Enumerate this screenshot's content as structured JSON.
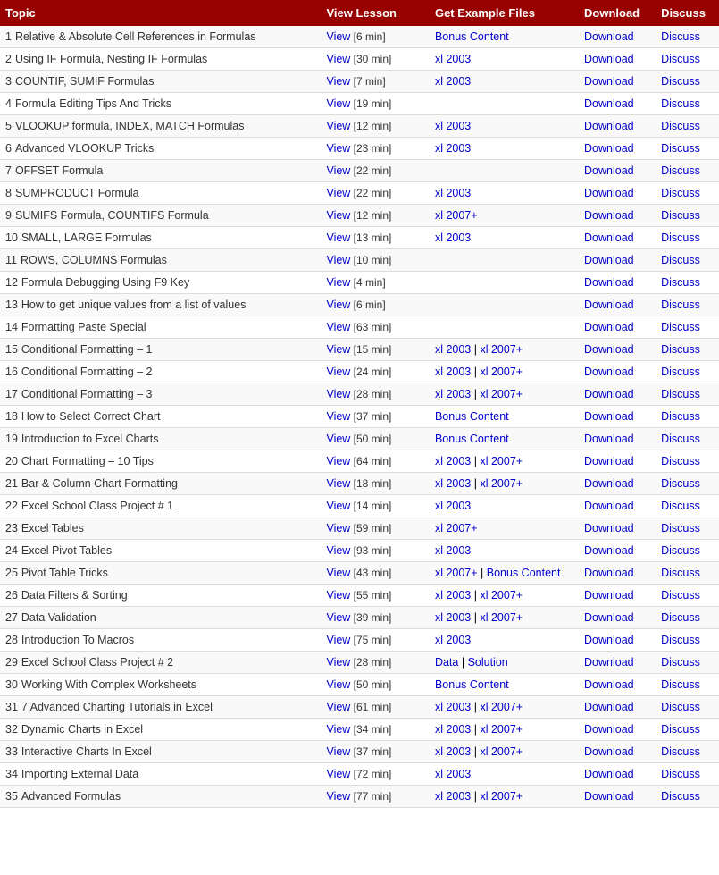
{
  "header": {
    "topic": "Topic",
    "view_lesson": "View Lesson",
    "get_example": "Get Example Files",
    "download": "Download",
    "discuss": "Discuss"
  },
  "rows": [
    {
      "num": 1,
      "topic": "Relative & Absolute Cell References in Formulas",
      "topic_link": false,
      "view": "View",
      "duration": "6 min",
      "example": [
        {
          "label": "Bonus Content",
          "type": "bonus"
        }
      ],
      "download": true,
      "discuss": true
    },
    {
      "num": 2,
      "topic": "Using IF Formula, Nesting IF Formulas",
      "topic_link": false,
      "view": "View",
      "duration": "30 min",
      "example": [
        {
          "label": "xl 2003",
          "type": "xl2003"
        }
      ],
      "download": true,
      "discuss": true
    },
    {
      "num": 3,
      "topic": "COUNTIF, SUMIF Formulas",
      "topic_link": false,
      "view": "View",
      "duration": "7 min",
      "example": [
        {
          "label": "xl 2003",
          "type": "xl2003"
        }
      ],
      "download": true,
      "discuss": true
    },
    {
      "num": 4,
      "topic": "Formula Editing Tips And Tricks",
      "topic_link": false,
      "view": "View",
      "duration": "19 min",
      "example": [],
      "download": true,
      "discuss": true
    },
    {
      "num": 5,
      "topic": "VLOOKUP formula, INDEX, MATCH Formulas",
      "topic_link": false,
      "view": "View",
      "duration": "12 min",
      "example": [
        {
          "label": "xl 2003",
          "type": "xl2003"
        }
      ],
      "download": true,
      "discuss": true
    },
    {
      "num": 6,
      "topic": "Advanced VLOOKUP Tricks",
      "topic_link": false,
      "view": "View",
      "duration": "23 min",
      "example": [
        {
          "label": "xl 2003",
          "type": "xl2003"
        }
      ],
      "download": true,
      "discuss": true
    },
    {
      "num": 7,
      "topic": "OFFSET Formula",
      "topic_link": false,
      "view": "View",
      "duration": "22 min",
      "example": [],
      "download": true,
      "discuss": true
    },
    {
      "num": 8,
      "topic": "SUMPRODUCT Formula",
      "topic_link": false,
      "view": "View",
      "duration": "22 min",
      "example": [
        {
          "label": "xl 2003",
          "type": "xl2003"
        }
      ],
      "download": true,
      "discuss": true
    },
    {
      "num": 9,
      "topic": "SUMIFS Formula, COUNTIFS Formula",
      "topic_link": false,
      "view": "View",
      "duration": "12 min",
      "example": [
        {
          "label": "xl 2007+",
          "type": "xl2007"
        }
      ],
      "download": true,
      "discuss": true
    },
    {
      "num": 10,
      "topic": "SMALL, LARGE Formulas",
      "topic_link": false,
      "view": "View",
      "duration": "13 min",
      "example": [
        {
          "label": "xl 2003",
          "type": "xl2003"
        }
      ],
      "download": true,
      "discuss": true
    },
    {
      "num": 11,
      "topic": "ROWS, COLUMNS Formulas",
      "topic_link": false,
      "view": "View",
      "duration": "10 min",
      "example": [],
      "download": true,
      "discuss": true
    },
    {
      "num": 12,
      "topic": "Formula Debugging Using F9 Key",
      "topic_link": false,
      "view": "View",
      "duration": "4 min",
      "example": [],
      "download": true,
      "discuss": true
    },
    {
      "num": 13,
      "topic": "How to get unique values from a list of values",
      "topic_link": false,
      "view": "View",
      "duration": "6 min",
      "example": [],
      "download": true,
      "discuss": true
    },
    {
      "num": 14,
      "topic": "Formatting Paste Special",
      "topic_link": false,
      "view": "View",
      "duration": "63 min",
      "example": [],
      "download": true,
      "discuss": true
    },
    {
      "num": 15,
      "topic": "Conditional Formatting – 1",
      "topic_link": false,
      "view": "View",
      "duration": "15 min",
      "example": [
        {
          "label": "xl 2003",
          "type": "xl2003"
        },
        {
          "label": "xl 2007+",
          "type": "xl2007"
        }
      ],
      "download": true,
      "discuss": true
    },
    {
      "num": 16,
      "topic": "Conditional Formatting – 2",
      "topic_link": false,
      "view": "View",
      "duration": "24 min",
      "example": [
        {
          "label": "xl 2003",
          "type": "xl2003"
        },
        {
          "label": "xl 2007+",
          "type": "xl2007"
        }
      ],
      "download": true,
      "discuss": true
    },
    {
      "num": 17,
      "topic": "Conditional Formatting – 3",
      "topic_link": false,
      "view": "View",
      "duration": "28 min",
      "example": [
        {
          "label": "xl 2003",
          "type": "xl2003"
        },
        {
          "label": "xl 2007+",
          "type": "xl2007"
        }
      ],
      "download": true,
      "discuss": true
    },
    {
      "num": 18,
      "topic": "How to Select Correct Chart",
      "topic_link": false,
      "view": "View",
      "duration": "37 min",
      "example": [
        {
          "label": "Bonus Content",
          "type": "bonus"
        }
      ],
      "download": true,
      "discuss": true
    },
    {
      "num": 19,
      "topic": "Introduction to Excel Charts",
      "topic_link": false,
      "view": "View",
      "duration": "50 min",
      "example": [
        {
          "label": "Bonus Content",
          "type": "bonus"
        }
      ],
      "download": true,
      "discuss": true
    },
    {
      "num": 20,
      "topic": "Chart Formatting – 10 Tips",
      "topic_link": false,
      "view": "View",
      "duration": "64 min",
      "example": [
        {
          "label": "xl 2003",
          "type": "xl2003"
        },
        {
          "label": "xl 2007+",
          "type": "xl2007"
        }
      ],
      "download": true,
      "discuss": true
    },
    {
      "num": 21,
      "topic": "Bar & Column Chart Formatting",
      "topic_link": false,
      "view": "View",
      "duration": "18 min",
      "example": [
        {
          "label": "xl 2003",
          "type": "xl2003"
        },
        {
          "label": "xl 2007+",
          "type": "xl2007"
        }
      ],
      "download": true,
      "discuss": true
    },
    {
      "num": 22,
      "topic": "Excel School Class Project # 1",
      "topic_link": false,
      "view": "View",
      "duration": "14 min",
      "example": [
        {
          "label": "xl 2003",
          "type": "xl2003"
        }
      ],
      "download": true,
      "discuss": true
    },
    {
      "num": 23,
      "topic": "Excel Tables",
      "topic_link": false,
      "view": "View",
      "duration": "59 min",
      "example": [
        {
          "label": "xl 2007+",
          "type": "xl2007"
        }
      ],
      "download": true,
      "discuss": true
    },
    {
      "num": 24,
      "topic": "Excel Pivot Tables",
      "topic_link": false,
      "view": "View",
      "duration": "93 min",
      "example": [
        {
          "label": "xl 2003",
          "type": "xl2003"
        }
      ],
      "download": true,
      "discuss": true
    },
    {
      "num": 25,
      "topic": "Pivot Table Tricks",
      "topic_link": false,
      "view": "View",
      "duration": "43 min",
      "example": [
        {
          "label": "xl 2007+",
          "type": "xl2007"
        },
        {
          "label": "Bonus Content",
          "type": "bonus"
        }
      ],
      "download": true,
      "discuss": true
    },
    {
      "num": 26,
      "topic": "Data Filters & Sorting",
      "topic_link": false,
      "view": "View",
      "duration": "55 min",
      "example": [
        {
          "label": "xl 2003",
          "type": "xl2003"
        },
        {
          "label": "xl 2007+",
          "type": "xl2007"
        }
      ],
      "download": true,
      "discuss": true
    },
    {
      "num": 27,
      "topic": "Data Validation",
      "topic_link": false,
      "view": "View",
      "duration": "39 min",
      "example": [
        {
          "label": "xl 2003",
          "type": "xl2003"
        },
        {
          "label": "xl 2007+",
          "type": "xl2007"
        }
      ],
      "download": true,
      "discuss": true
    },
    {
      "num": 28,
      "topic": "Introduction To Macros",
      "topic_link": false,
      "view": "View",
      "duration": "75 min",
      "example": [
        {
          "label": "xl 2003",
          "type": "xl2003"
        }
      ],
      "download": true,
      "discuss": true
    },
    {
      "num": 29,
      "topic": "Excel School Class Project # 2",
      "topic_link": false,
      "view": "View",
      "duration": "28 min",
      "example": [
        {
          "label": "Data",
          "type": "data"
        },
        {
          "label": "Solution",
          "type": "solution"
        }
      ],
      "download": true,
      "discuss": true
    },
    {
      "num": 30,
      "topic": "Working With Complex Worksheets",
      "topic_link": false,
      "view": "View",
      "duration": "50 min",
      "example": [
        {
          "label": "Bonus Content",
          "type": "bonus"
        }
      ],
      "download": true,
      "discuss": true
    },
    {
      "num": 31,
      "topic": "7 Advanced Charting Tutorials in Excel",
      "topic_link": false,
      "view": "View",
      "duration": "61 min",
      "example": [
        {
          "label": "xl 2003",
          "type": "xl2003"
        },
        {
          "label": "xl 2007+",
          "type": "xl2007"
        }
      ],
      "download": true,
      "discuss": true
    },
    {
      "num": 32,
      "topic": "Dynamic Charts in Excel",
      "topic_link": false,
      "view": "View",
      "duration": "34 min",
      "example": [
        {
          "label": "xl 2003",
          "type": "xl2003"
        },
        {
          "label": "xl 2007+",
          "type": "xl2007"
        }
      ],
      "download": true,
      "discuss": true
    },
    {
      "num": 33,
      "topic": "Interactive Charts In Excel",
      "topic_link": false,
      "view": "View",
      "duration": "37 min",
      "example": [
        {
          "label": "xl 2003",
          "type": "xl2003"
        },
        {
          "label": "xl 2007+",
          "type": "xl2007"
        }
      ],
      "download": true,
      "discuss": true
    },
    {
      "num": 34,
      "topic": "Importing External Data",
      "topic_link": false,
      "view": "View",
      "duration": "72 min",
      "example": [
        {
          "label": "xl 2003",
          "type": "xl2003"
        }
      ],
      "download": true,
      "discuss": true
    },
    {
      "num": 35,
      "topic": "Advanced Formulas",
      "topic_link": false,
      "view": "View",
      "duration": "77 min",
      "example": [
        {
          "label": "xl 2003",
          "type": "xl2003"
        },
        {
          "label": "xl 2007+",
          "type": "xl2007"
        }
      ],
      "download": true,
      "discuss": true
    }
  ],
  "labels": {
    "download": "Download",
    "discuss": "Discuss"
  }
}
